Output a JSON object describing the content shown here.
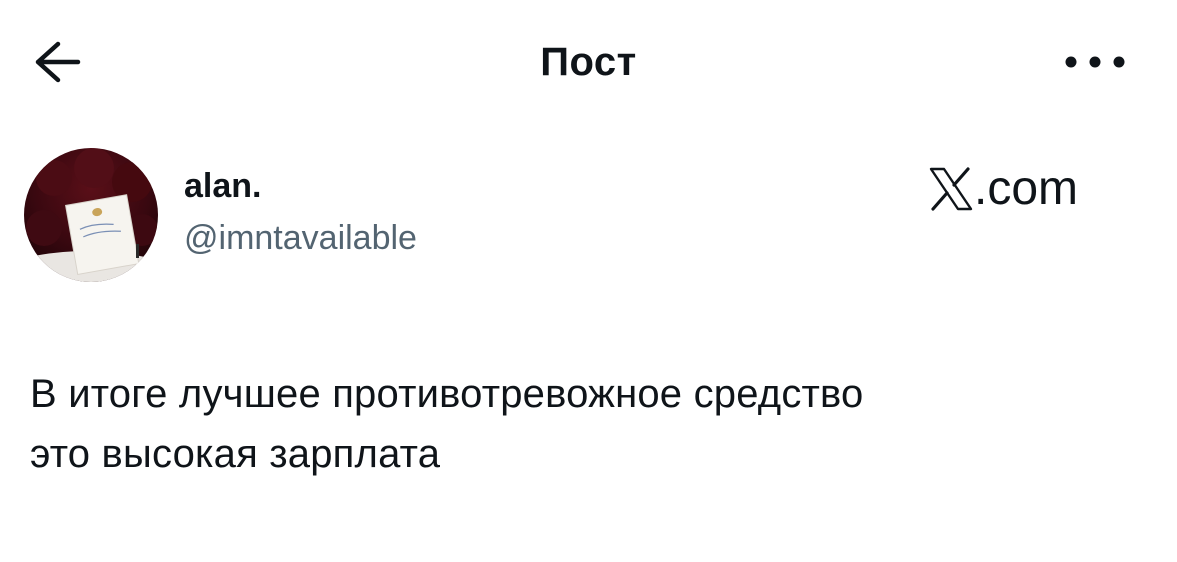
{
  "header": {
    "title": "Пост",
    "back_icon": "arrow-left-icon",
    "more_icon": "more-horizontal-icon"
  },
  "author": {
    "display_name": "alan.",
    "handle": "@imntavailable",
    "avatar_icon": "avatar-photo"
  },
  "brand": {
    "logo_icon": "x-logo-icon",
    "text": ".com"
  },
  "post": {
    "line1": "В итоге лучшее противотревожное средство",
    "line2": "это высокая зарплата"
  },
  "colors": {
    "text_primary": "#0f1419",
    "text_secondary": "#536471",
    "background": "#ffffff"
  }
}
